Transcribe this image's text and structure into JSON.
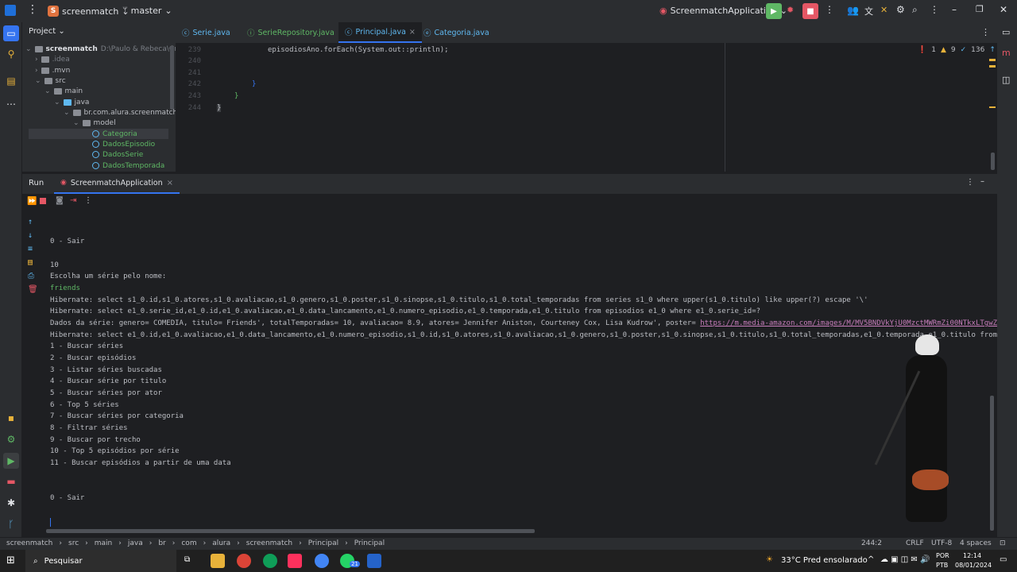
{
  "titlebar": {
    "project_badge": "S",
    "project": "screenmatch",
    "branch": "master",
    "run_config": "ScreenmatchApplication",
    "colors": {
      "run": "#5fb865",
      "stop": "#e55765"
    }
  },
  "project_panel": {
    "title": "Project",
    "items": [
      {
        "label": "screenmatch",
        "hint": "D:\\Paulo & Rebeca\\Cruso"
      },
      {
        "label": ".idea"
      },
      {
        "label": ".mvn"
      },
      {
        "label": "src"
      },
      {
        "label": "main"
      },
      {
        "label": "java"
      },
      {
        "label": "br.com.alura.screenmatch"
      },
      {
        "label": "model"
      },
      {
        "label": "Categoria"
      },
      {
        "label": "DadosEpisodio"
      },
      {
        "label": "DadosSerie"
      },
      {
        "label": "DadosTemporada"
      }
    ]
  },
  "editor": {
    "tabs": [
      {
        "label": "Serie.java"
      },
      {
        "label": "SerieRepository.java"
      },
      {
        "label": "Principal.java"
      },
      {
        "label": "Categoria.java"
      }
    ],
    "inspections": {
      "errors": "1",
      "warnings": "9",
      "typos": "136"
    },
    "lines": [
      {
        "num": "239",
        "code": "episodiosAno.forEach(System.out::println);"
      },
      {
        "num": "240",
        "code": ""
      },
      {
        "num": "241",
        "code": ""
      },
      {
        "num": "242",
        "code": "}"
      },
      {
        "num": "243",
        "code": "}"
      },
      {
        "num": "244",
        "code": "}"
      }
    ]
  },
  "run_panel": {
    "tab_run": "Run",
    "tab_app": "ScreenmatchApplication",
    "console": [
      "0 - Sair",
      "",
      "10",
      "Escolha um série pelo nome:",
      "friends",
      "Hibernate: select s1_0.id,s1_0.atores,s1_0.avaliacao,s1_0.genero,s1_0.poster,s1_0.sinopse,s1_0.titulo,s1_0.total_temporadas from series s1_0 where upper(s1_0.titulo) like upper(?) escape '\\'",
      "Hibernate: select e1_0.serie_id,e1_0.id,e1_0.avaliacao,e1_0.data_lancamento,e1_0.numero_episodio,e1_0.temporada,e1_0.titulo from episodios e1_0 where e1_0.serie_id=?",
      "Dados da série: genero= COMEDIA, titulo= Friends', totalTemporadas= 10, avaliacao= 8.9, atores= Jennifer Aniston, Courteney Cox, Lisa Kudrow', poster= ",
      "Hibernate: select e1_0.id,e1_0.avaliacao,e1_0.data_lancamento,e1_0.numero_episodio,s1_0.id,s1_0.atores,s1_0.avaliacao,s1_0.genero,s1_0.poster,s1_0.sinopse,s1_0.titulo,s1_0.total_temporadas,e1_0.temporada,e1_0.titulo from se",
      "1 - Buscar séries",
      "2 - Buscar episódios",
      "3 - Listar séries buscadas",
      "4 - Buscar série por titulo",
      "5 - Buscar séries por ator",
      "6 - Top 5 séries",
      "7 - Buscar séries por categoria",
      "8 - Filtrar séries",
      "9 - Buscar por trecho",
      "10 - Top 5 episódios por série",
      "11 - Buscar episódios a partir de uma data",
      "",
      "",
      "0 - Sair"
    ],
    "poster_link": "https://m.media-amazon.com/images/M/MV5BNDVkYjU0MzctMWRmZi00NTkxLTgwZWEt"
  },
  "statusbar": {
    "breadcrumb": [
      "screenmatch",
      "src",
      "main",
      "java",
      "br",
      "com",
      "alura",
      "screenmatch",
      "Principal",
      "Principal"
    ],
    "position": "244:2",
    "line_sep": "CRLF",
    "encoding": "UTF-8",
    "indent": "4 spaces"
  },
  "taskbar": {
    "search": "Pesquisar",
    "weather": "33°C  Pred ensolarado",
    "lang1": "POR",
    "lang2": "PTB",
    "time": "12:14",
    "date": "08/01/2024",
    "badge": "21"
  }
}
